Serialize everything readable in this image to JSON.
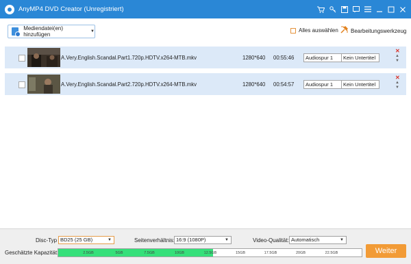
{
  "window": {
    "title": "AnyMP4 DVD Creator (Unregistriert)",
    "icons": [
      "cart-icon",
      "key-icon",
      "save-icon",
      "feedback-icon",
      "menu-icon",
      "minimize-icon",
      "maximize-icon",
      "close-icon"
    ]
  },
  "toolbar": {
    "add_media_label": "Mediendatei(en) hinzufügen",
    "select_all_label": "Alles auswählen",
    "edit_tool_label": "Bearbeitungswerkzeug"
  },
  "files": [
    {
      "name": "A.Very.English.Scandal.Part1.720p.HDTV.x264-MTB.mkv",
      "resolution": "1280*640",
      "duration": "00:55:46",
      "audio": "Audiospur 1",
      "subtitle": "Kein Untertitel"
    },
    {
      "name": "A.Very.English.Scandal.Part2.720p.HDTV.x264-MTB.mkv",
      "resolution": "1280*640",
      "duration": "00:54:57",
      "audio": "Audiospur 1",
      "subtitle": "Kein Untertitel"
    }
  ],
  "settings": {
    "disc_type_label": "Disc-Typ",
    "disc_type_value": "BD25 (25 GB)",
    "aspect_label": "Seitenverhältnis:",
    "aspect_value": "16:9 (1080P)",
    "quality_label": "Video-Qualität:",
    "quality_value": "Automatisch",
    "capacity_label": "Geschätzte Kapazität:",
    "capacity_used_fraction": 0.51,
    "capacity_ticks": [
      "2.5GB",
      "5GB",
      "7.5GB",
      "10GB",
      "12.5GB",
      "15GB",
      "17.5GB",
      "20GB",
      "22.5GB"
    ],
    "next_button": "Weiter"
  },
  "colors": {
    "titlebar": "#2a87d6",
    "row_background": "#dce9f8",
    "capacity_fill": "#35e07a",
    "next_button": "#f29b36"
  }
}
